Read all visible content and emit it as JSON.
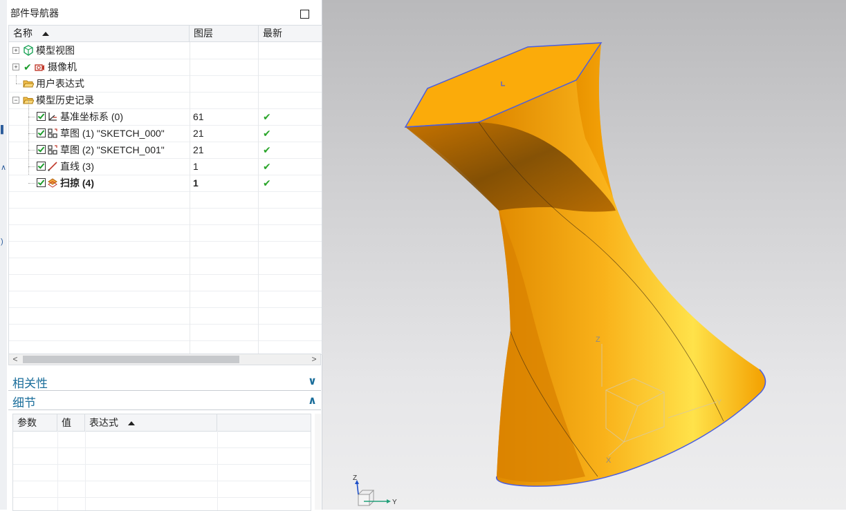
{
  "navigator": {
    "title": "部件导航器",
    "columns": {
      "name": "名称",
      "layer": "图层",
      "latest": "最新"
    },
    "tree": [
      {
        "label": "模型视图",
        "layer": "",
        "latest": ""
      },
      {
        "label": "摄像机",
        "layer": "",
        "latest": ""
      },
      {
        "label": "用户表达式",
        "layer": "",
        "latest": ""
      },
      {
        "label": "模型历史记录",
        "layer": "",
        "latest": ""
      },
      {
        "label": "基准坐标系 (0)",
        "layer": "61",
        "latest": "✔"
      },
      {
        "label": "草图 (1) \"SKETCH_000\"",
        "layer": "21",
        "latest": "✔"
      },
      {
        "label": "草图 (2) \"SKETCH_001\"",
        "layer": "21",
        "latest": "✔"
      },
      {
        "label": "直线 (3)",
        "layer": "1",
        "latest": "✔"
      },
      {
        "label": "扫掠 (4)",
        "layer": "1",
        "latest": "✔"
      }
    ],
    "expanders": {
      "plus": "+",
      "minus": "−"
    },
    "scroll": {
      "left": "<",
      "right": ">"
    }
  },
  "dependency_panel": {
    "title": "相关性",
    "chevron": "∨"
  },
  "details_panel": {
    "title": "细节",
    "chevron": "∧",
    "columns": {
      "param": "参数",
      "value": "值",
      "expression": "表达式"
    }
  },
  "viewport": {
    "triad": {
      "z": "Z",
      "y": "Y",
      "x": "X"
    },
    "colors": {
      "solid": "#f7a608",
      "edge": "#4a5ee0",
      "background": "#c8c8ca"
    }
  }
}
